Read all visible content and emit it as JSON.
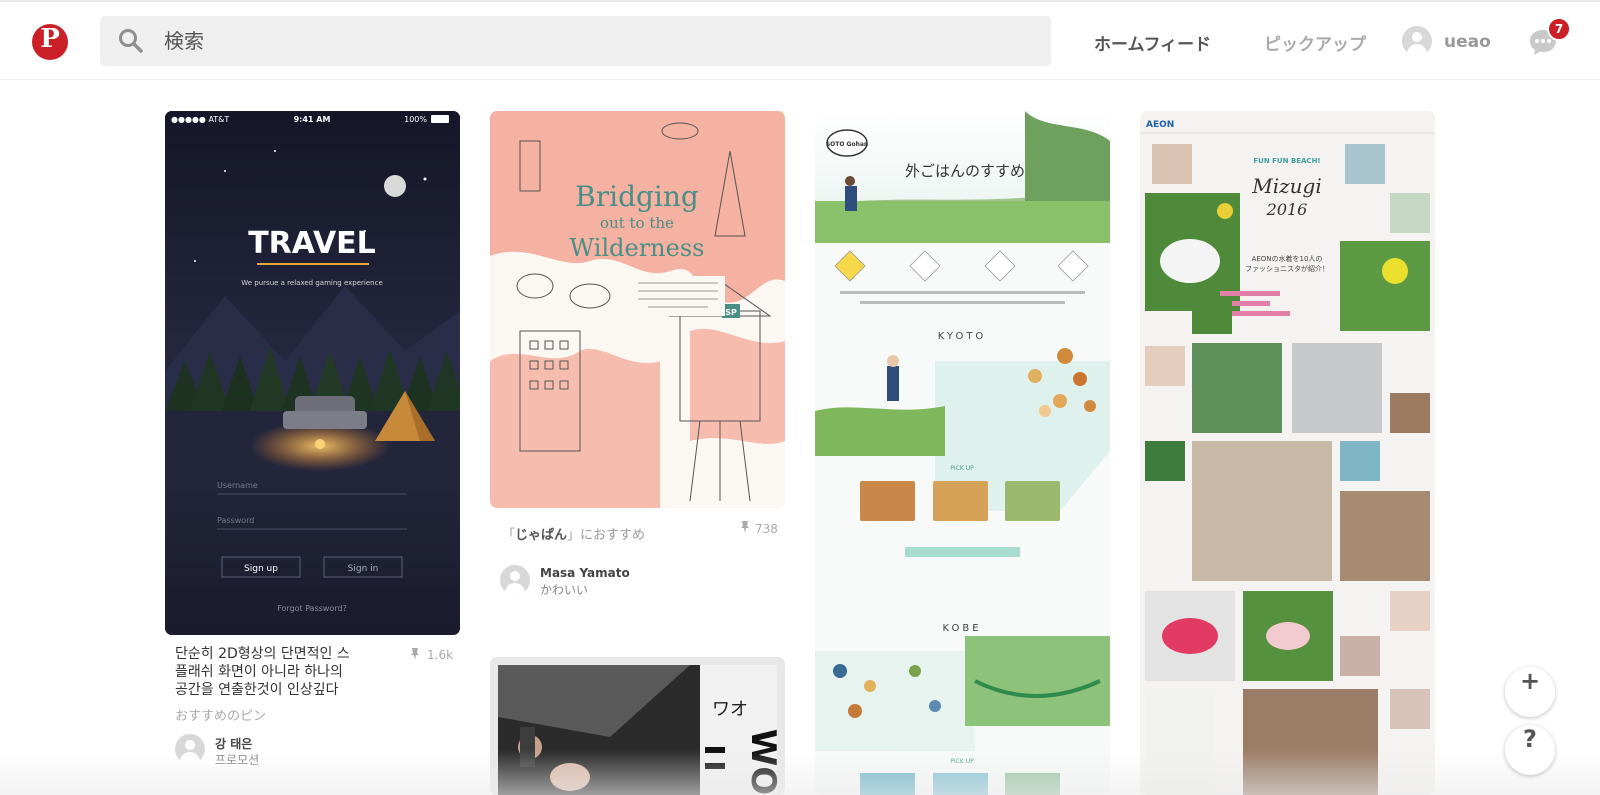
{
  "header": {
    "logo_letter": "P",
    "search_placeholder": "検索",
    "nav_home": "ホームフィード",
    "nav_pickup": "ピックアップ",
    "user_name": "ueao",
    "notification_count": "7",
    "brand_color": "#cb2027"
  },
  "pins": [
    {
      "image": {
        "status_carrier": "●●●●● AT&T",
        "status_time": "9:41 AM",
        "status_battery": "100%",
        "title": "TRAVEL",
        "tagline": "We pursue a relaxed gaming experience",
        "username_placeholder": "Username",
        "password_placeholder": "Password",
        "signup": "Sign up",
        "signin": "Sign in",
        "forgot": "Forgot Password?"
      },
      "description_line1": "단순히 2D형상의 단면적인 스",
      "description_line2": "플래쉬 화면이 아니라 하나의",
      "description_line3": "공간을 연출한것이 인상깊다",
      "save_count": "1.6k",
      "recommend": "おすすめのピン",
      "pinner_name": "강 태은",
      "pinner_board": "프로모션"
    },
    {
      "image": {
        "title_line1": "Bridging",
        "title_line2": "out to the",
        "title_line3": "Wilderness",
        "sign": "SP"
      },
      "recommend_prefix": "「",
      "recommend_keyword": "じゃぱん",
      "recommend_suffix": "」におすすめ",
      "save_count": "738",
      "pinner_name": "Masa Yamato",
      "pinner_board": "かわいい"
    },
    {
      "image": {
        "badge": "SOTO Gohan",
        "title": "外ごはんのすすめ",
        "section1": "KYOTO",
        "pickup1": "PICK UP",
        "section2": "KOBE",
        "pickup2": "PICK UP"
      }
    },
    {
      "image": {
        "brand": "AEON",
        "title_line1": "FUN FUN BEACH!",
        "title_line2": "Mizugi",
        "title_line3": "2016",
        "caption_line1": "AEONの水着を10人の",
        "caption_line2": "ファッショニスタが紹介！"
      }
    },
    {
      "image": {
        "sign_text": "ワオ",
        "sign_vertical": "WO"
      }
    }
  ],
  "fab": {
    "add": "+",
    "help": "?"
  }
}
